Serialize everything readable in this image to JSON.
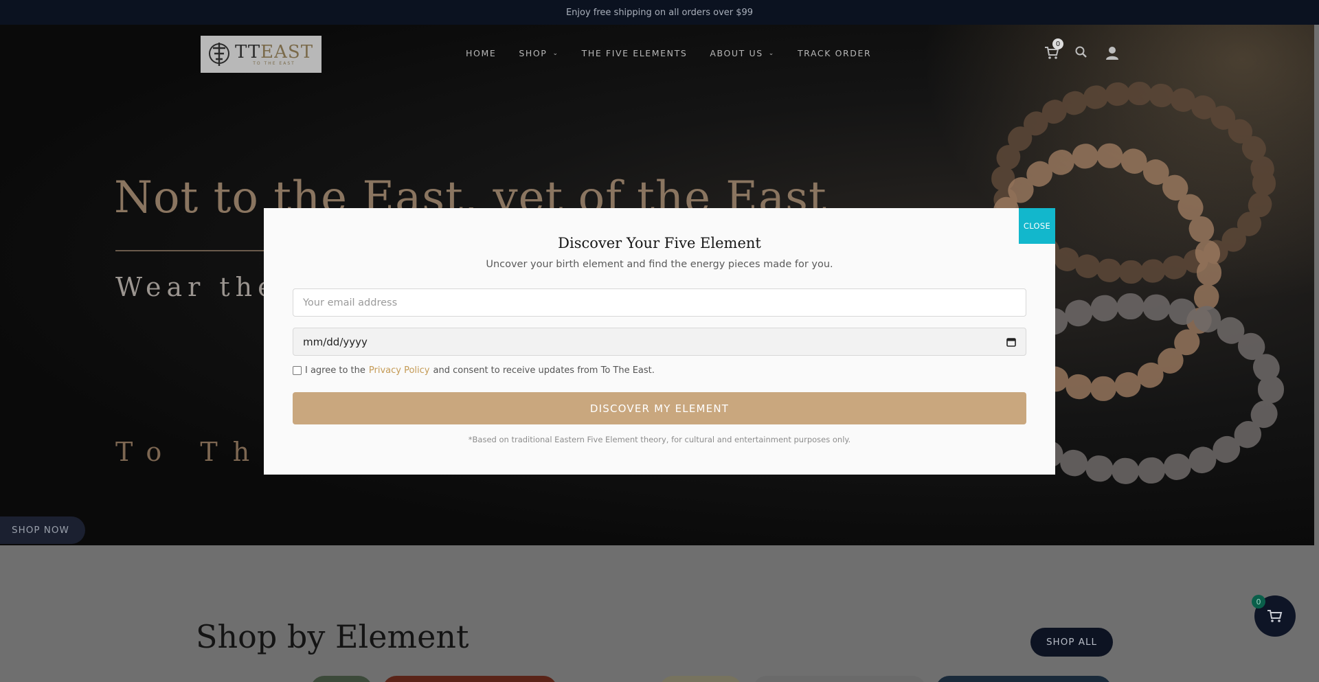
{
  "announcement": "Enjoy free shipping on all orders over $99",
  "header": {
    "logo_main": "TT",
    "logo_accent": "EAST",
    "logo_tag": "TO THE EAST",
    "nav": [
      {
        "label": "HOME"
      },
      {
        "label": "SHOP"
      },
      {
        "label": "THE FIVE ELEMENTS"
      },
      {
        "label": "ABOUT US"
      },
      {
        "label": "TRACK ORDER"
      }
    ],
    "cart_count": "0"
  },
  "hero": {
    "title": "Not to the East, yet of the East",
    "subtitle": "Wear the",
    "tagline": "To The",
    "cta": "SHOP NOW"
  },
  "section": {
    "title": "Shop by Element",
    "shop_all": "SHOP ALL"
  },
  "floating_cart": {
    "count": "0"
  },
  "modal": {
    "close": "CLOSE",
    "title": "Discover Your Five Element",
    "subtitle": "Uncover your birth element and find the energy pieces made for you.",
    "email_placeholder": "Your email address",
    "date_placeholder": "mm/dd/yyyy",
    "consent_prefix": "I agree to the",
    "consent_link": "Privacy Policy",
    "consent_suffix": "and consent to receive updates from To The East.",
    "submit": "DISCOVER MY ELEMENT",
    "disclaimer": "*Based on traditional Eastern Five Element theory, for cultural and entertainment purposes only."
  },
  "colors": {
    "accent_gold": "#c9a77e",
    "close_teal": "#12b7cc",
    "navy": "#0d1322"
  }
}
